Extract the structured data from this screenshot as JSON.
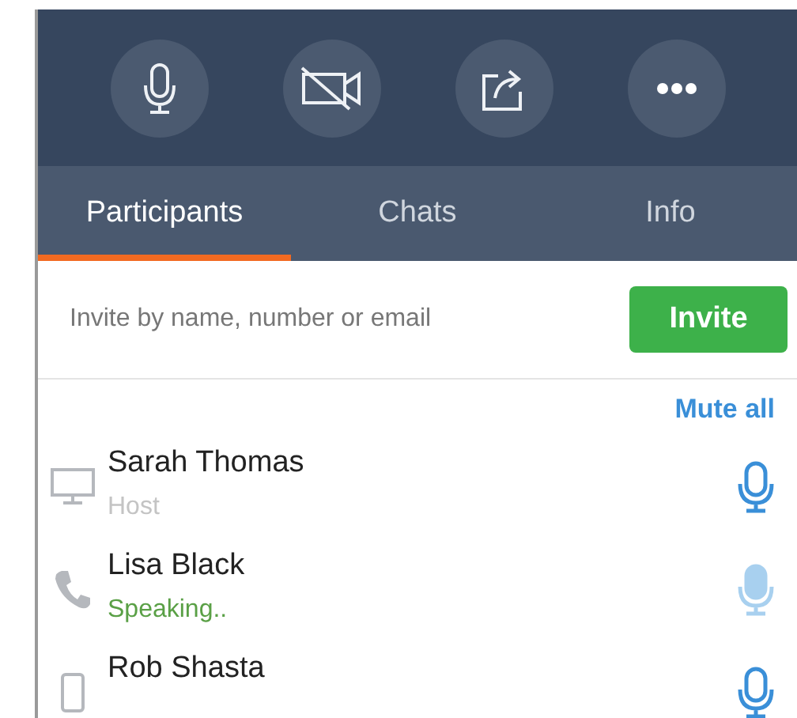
{
  "toolbar": [
    {
      "kind": "mic"
    },
    {
      "kind": "camera-off"
    },
    {
      "kind": "share"
    },
    {
      "kind": "more"
    }
  ],
  "tabs": [
    {
      "label": "Participants",
      "selected": true
    },
    {
      "label": "Chats",
      "selected": false
    },
    {
      "label": "Info",
      "selected": false
    }
  ],
  "invite": {
    "placeholder": "Invite by name, number or email",
    "button": "Invite"
  },
  "mute_all": "Mute all",
  "participants": [
    {
      "name": "Sarah Thomas",
      "status": "Host",
      "kind": "desktop",
      "speaking": false
    },
    {
      "name": "Lisa Black",
      "status": "Speaking..",
      "kind": "phone",
      "speaking": true
    },
    {
      "name": "Rob Shasta",
      "kind": "mobile",
      "speaking": false
    }
  ]
}
